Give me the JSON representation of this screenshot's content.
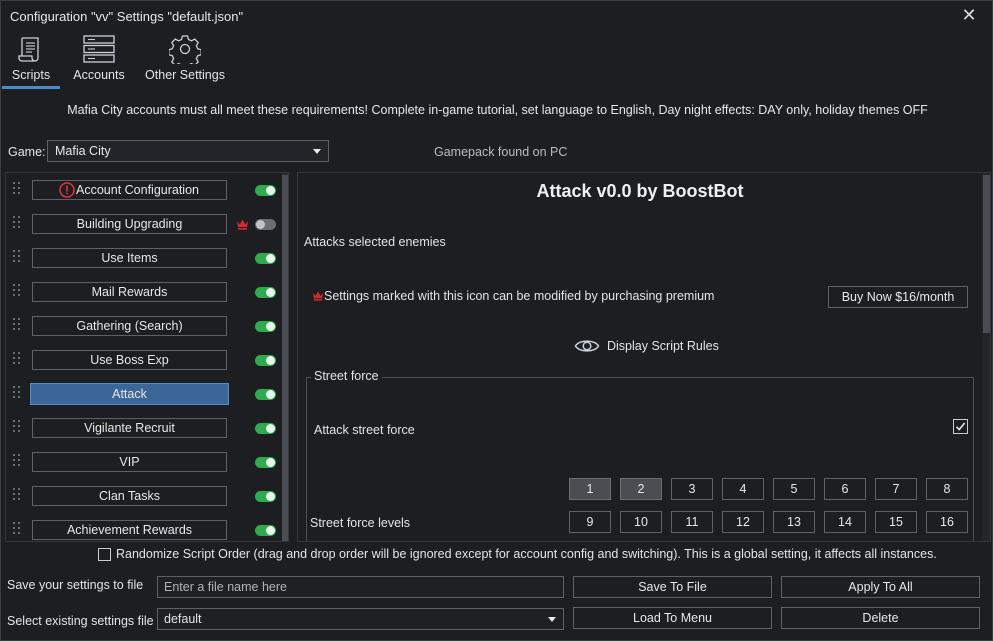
{
  "window": {
    "title": "Configuration \"vv\" Settings \"default.json\"",
    "close_glyph": "✕"
  },
  "tabs": [
    {
      "label": "Scripts",
      "icon": "scroll-icon",
      "active": true
    },
    {
      "label": "Accounts",
      "icon": "server-icon",
      "active": false
    },
    {
      "label": "Other Settings",
      "icon": "gear-icon",
      "active": false
    }
  ],
  "notice": "Mafia City accounts must all meet these requirements! Complete in-game tutorial, set language to English, Day night effects: DAY only, holiday themes OFF",
  "game": {
    "label": "Game:",
    "value": "Mafia City",
    "status": "Gamepack found on PC"
  },
  "scripts": [
    {
      "label": "Account Configuration",
      "enabled": true,
      "warning": true
    },
    {
      "label": "Building Upgrading",
      "enabled": false,
      "premium": true
    },
    {
      "label": "Use Items",
      "enabled": true
    },
    {
      "label": "Mail Rewards",
      "enabled": true
    },
    {
      "label": "Gathering (Search)",
      "enabled": true
    },
    {
      "label": "Use Boss Exp",
      "enabled": true
    },
    {
      "label": "Attack",
      "enabled": true,
      "active": true
    },
    {
      "label": "Vigilante Recruit",
      "enabled": true
    },
    {
      "label": "VIP",
      "enabled": true
    },
    {
      "label": "Clan Tasks",
      "enabled": true
    },
    {
      "label": "Achievement Rewards",
      "enabled": true
    }
  ],
  "main": {
    "title": "Attack v0.0 by BoostBot",
    "description": "Attacks selected enemies",
    "premium_note": "Settings marked with this icon can be modified by purchasing premium",
    "buy_label": "Buy Now $16/month",
    "rules_label": "Display Script Rules",
    "group_title": "Street force",
    "attack_label": "Attack street force",
    "attack_checked": true,
    "levels_label": "Street force levels",
    "levels": [
      "1",
      "2",
      "3",
      "4",
      "5",
      "6",
      "7",
      "8",
      "9",
      "10",
      "11",
      "12",
      "13",
      "14",
      "15",
      "16"
    ],
    "selected_levels": [
      "1",
      "2"
    ]
  },
  "bottom": {
    "randomize_label": "Randomize Script Order (drag and drop order will be ignored except for account config and switching). This is a global setting, it affects all instances.",
    "save_label": "Save your settings to file",
    "select_label": "Select existing settings file",
    "file_placeholder": "Enter a file name here",
    "file_value": "default",
    "save_button": "Save To File",
    "apply_button": "Apply To All",
    "load_button": "Load To Menu",
    "delete_button": "Delete"
  },
  "colors": {
    "accent": "#4a8bcf",
    "active_script": "#3a6699",
    "toggle_on": "#2fab4f",
    "premium": "#d42b2b"
  }
}
